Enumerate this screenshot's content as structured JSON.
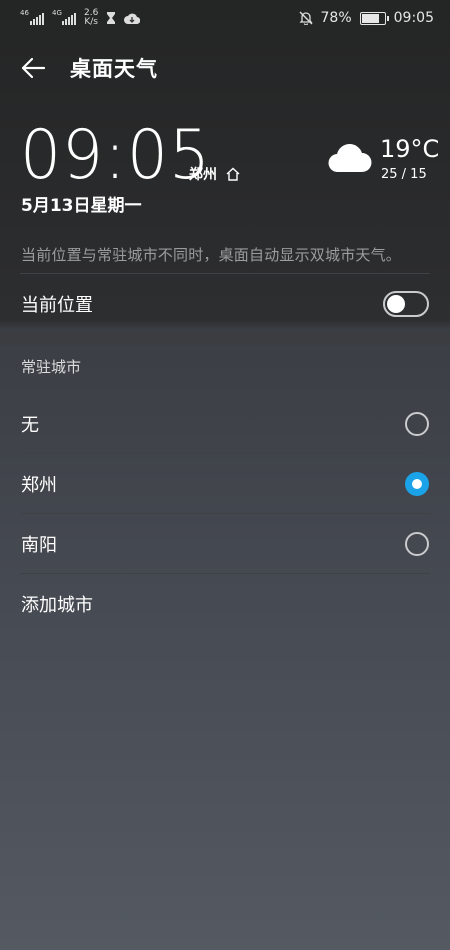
{
  "status_bar": {
    "signal1_tag": "46",
    "signal2_tag": "4G",
    "speed_value": "2.6",
    "speed_unit": "K/s",
    "battery": "78%",
    "time": "09:05"
  },
  "header": {
    "title": "桌面天气"
  },
  "clock": {
    "time": "09:05",
    "city": "郑州",
    "date": "5月13日星期一"
  },
  "weather": {
    "icon": "cloud-icon",
    "temperature": "19°C",
    "range": "25 / 15"
  },
  "description": "当前位置与常驻城市不同时，桌面自动显示双城市天气。",
  "current_location": {
    "label": "当前位置",
    "enabled": false
  },
  "resident_city": {
    "header": "常驻城市",
    "options": [
      {
        "label": "无",
        "selected": false
      },
      {
        "label": "郑州",
        "selected": true
      },
      {
        "label": "南阳",
        "selected": false
      }
    ],
    "add_label": "添加城市"
  },
  "colors": {
    "accent": "#1aa3e8",
    "text": "#ffffff",
    "muted": "#9a9c9e"
  }
}
